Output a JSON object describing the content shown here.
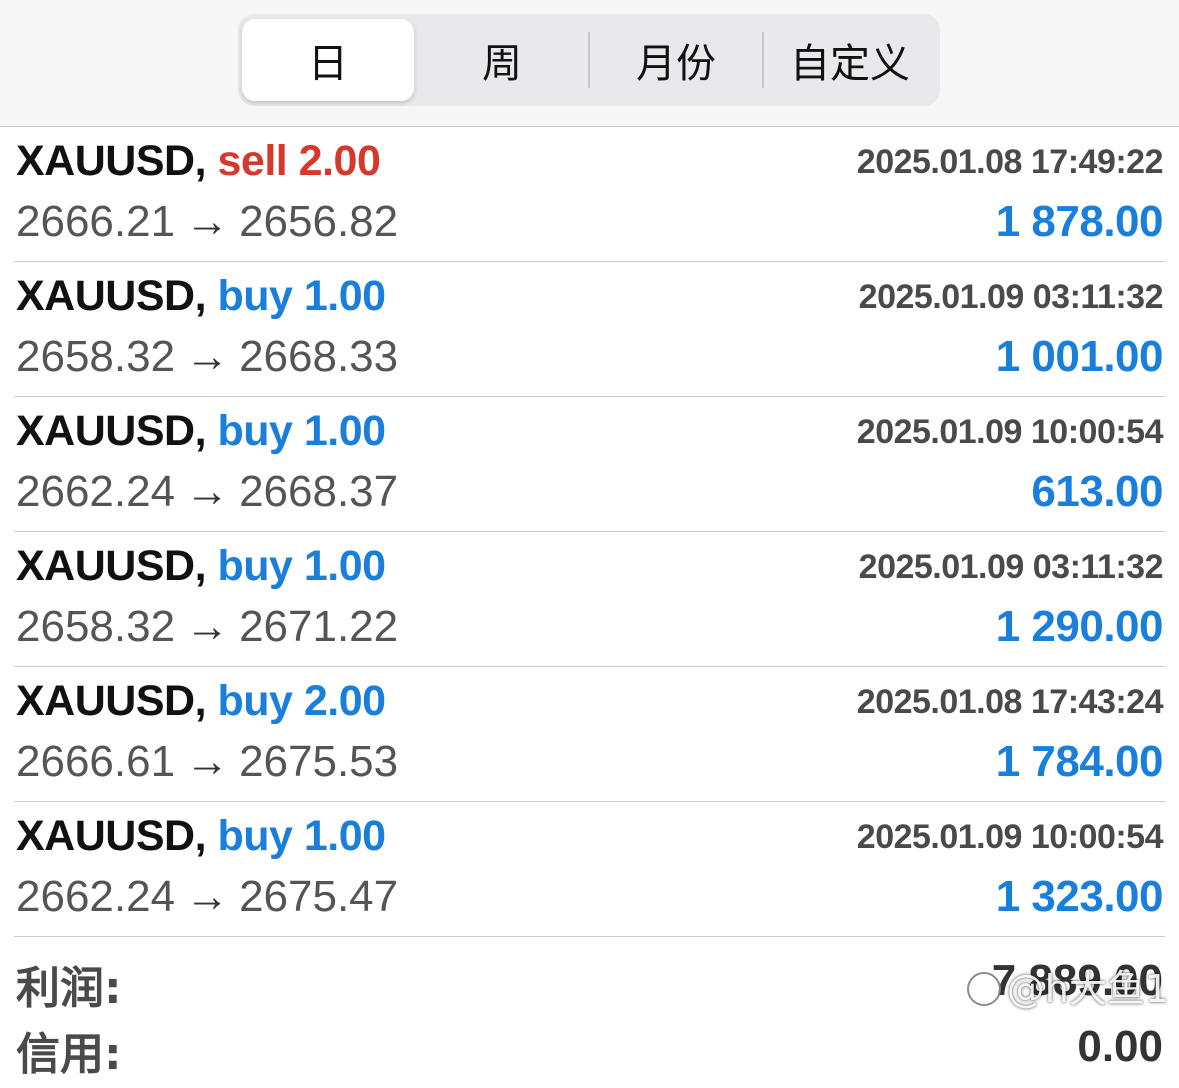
{
  "tabs": [
    {
      "label": "日",
      "active": true
    },
    {
      "label": "周",
      "active": false
    },
    {
      "label": "月份",
      "active": false
    },
    {
      "label": "自定义",
      "active": false
    }
  ],
  "trades": [
    {
      "symbol": "XAUUSD,",
      "side": "sell",
      "volume": "2.00",
      "time": "2025.01.08 17:49:22",
      "open": "2666.21",
      "close": "2656.82",
      "profit": "1 878.00"
    },
    {
      "symbol": "XAUUSD,",
      "side": "buy",
      "volume": "1.00",
      "time": "2025.01.09 03:11:32",
      "open": "2658.32",
      "close": "2668.33",
      "profit": "1 001.00"
    },
    {
      "symbol": "XAUUSD,",
      "side": "buy",
      "volume": "1.00",
      "time": "2025.01.09 10:00:54",
      "open": "2662.24",
      "close": "2668.37",
      "profit": "613.00"
    },
    {
      "symbol": "XAUUSD,",
      "side": "buy",
      "volume": "1.00",
      "time": "2025.01.09 03:11:32",
      "open": "2658.32",
      "close": "2671.22",
      "profit": "1 290.00"
    },
    {
      "symbol": "XAUUSD,",
      "side": "buy",
      "volume": "2.00",
      "time": "2025.01.08 17:43:24",
      "open": "2666.61",
      "close": "2675.53",
      "profit": "1 784.00"
    },
    {
      "symbol": "XAUUSD,",
      "side": "buy",
      "volume": "1.00",
      "time": "2025.01.09 10:00:54",
      "open": "2662.24",
      "close": "2675.47",
      "profit": "1 323.00"
    }
  ],
  "arrow": "→",
  "summary": {
    "profit_label": "利润:",
    "profit_value": "7 889.00",
    "credit_label": "信用:",
    "credit_value": "0.00"
  },
  "watermark": "@h大鱼1",
  "colors": {
    "sell": "#d6382c",
    "buy": "#1a7fdb",
    "profit": "#1a7fdb"
  }
}
